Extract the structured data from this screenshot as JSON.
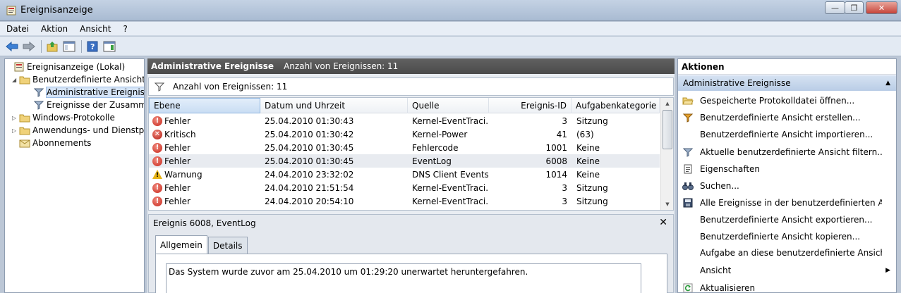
{
  "window": {
    "title": "Ereignisanzeige"
  },
  "menu": [
    "Datei",
    "Aktion",
    "Ansicht",
    "?"
  ],
  "tree": [
    {
      "label": "Ereignisanzeige (Lokal)",
      "indent": 0,
      "expander": "",
      "icon": "event-viewer-icon"
    },
    {
      "label": "Benutzerdefinierte Ansichten",
      "indent": 1,
      "expander": "◢",
      "icon": "folder-icon"
    },
    {
      "label": "Administrative Ereignisse",
      "indent": 2,
      "expander": "",
      "icon": "filter-icon",
      "selected": true
    },
    {
      "label": "Ereignisse der Zusammenfassung",
      "indent": 2,
      "expander": "",
      "icon": "filter-icon"
    },
    {
      "label": "Windows-Protokolle",
      "indent": 1,
      "expander": "▷",
      "icon": "folder-icon"
    },
    {
      "label": "Anwendungs- und Dienstprotokolle",
      "indent": 1,
      "expander": "▷",
      "icon": "folder-icon"
    },
    {
      "label": "Abonnements",
      "indent": 1,
      "expander": "",
      "icon": "subscriptions-icon"
    }
  ],
  "middle": {
    "title": "Administrative Ereignisse",
    "count_text": "Anzahl von Ereignissen: 11",
    "filter_text": "Anzahl von Ereignissen: 11"
  },
  "columns": [
    "Ebene",
    "Datum und Uhrzeit",
    "Quelle",
    "Ereignis-ID",
    "Aufgabenkategorie"
  ],
  "events": [
    {
      "level": "Fehler",
      "kind": "err",
      "datetime": "25.04.2010 01:30:43",
      "source": "Kernel-EventTraci...",
      "id": "3",
      "category": "Sitzung"
    },
    {
      "level": "Kritisch",
      "kind": "crit",
      "datetime": "25.04.2010 01:30:42",
      "source": "Kernel-Power",
      "id": "41",
      "category": "(63)"
    },
    {
      "level": "Fehler",
      "kind": "err",
      "datetime": "25.04.2010 01:30:45",
      "source": "Fehlercode",
      "id": "1001",
      "category": "Keine"
    },
    {
      "level": "Fehler",
      "kind": "err",
      "datetime": "25.04.2010 01:30:45",
      "source": "EventLog",
      "id": "6008",
      "category": "Keine",
      "selected": true
    },
    {
      "level": "Warnung",
      "kind": "warn",
      "datetime": "24.04.2010 23:32:02",
      "source": "DNS Client Events",
      "id": "1014",
      "category": "Keine"
    },
    {
      "level": "Fehler",
      "kind": "err",
      "datetime": "24.04.2010 21:51:54",
      "source": "Kernel-EventTraci...",
      "id": "3",
      "category": "Sitzung"
    },
    {
      "level": "Fehler",
      "kind": "err",
      "datetime": "24.04.2010 20:54:10",
      "source": "Kernel-EventTraci...",
      "id": "3",
      "category": "Sitzung"
    }
  ],
  "detail": {
    "title": "Ereignis 6008, EventLog",
    "tabs": [
      "Allgemein",
      "Details"
    ],
    "message": "Das System wurde zuvor am 25.04.2010 um 01:29:20 unerwartet heruntergefahren."
  },
  "actions": {
    "header": "Aktionen",
    "section": "Administrative Ereignisse",
    "items": [
      {
        "label": "Gespeicherte Protokolldatei öffnen...",
        "icon": "open-folder-icon"
      },
      {
        "label": "Benutzerdefinierte Ansicht erstellen...",
        "icon": "filter-create-icon"
      },
      {
        "label": "Benutzerdefinierte Ansicht importieren...",
        "icon": ""
      },
      {
        "label": "Aktuelle benutzerdefinierte Ansicht filtern...",
        "icon": "filter-icon"
      },
      {
        "label": "Eigenschaften",
        "icon": "properties-icon"
      },
      {
        "label": "Suchen...",
        "icon": "binoculars-icon"
      },
      {
        "label": "Alle Ereignisse in der benutzerdefinierten Ansicht speichern unter...",
        "icon": "save-disk-icon"
      },
      {
        "label": "Benutzerdefinierte Ansicht exportieren...",
        "icon": ""
      },
      {
        "label": "Benutzerdefinierte Ansicht kopieren...",
        "icon": ""
      },
      {
        "label": "Aufgabe an diese benutzerdefinierte Ansicht anfügen...",
        "icon": ""
      },
      {
        "label": "Ansicht",
        "icon": "",
        "submenu": true
      },
      {
        "label": "Aktualisieren",
        "icon": "refresh-icon"
      }
    ]
  }
}
